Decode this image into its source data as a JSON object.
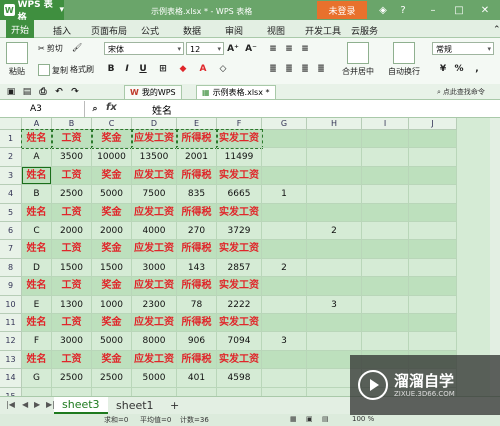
{
  "titlebar": {
    "app_name": "WPS 表格",
    "tabs": [
      "示例表格.xlsx * - WPS 表格"
    ],
    "login": "未登录"
  },
  "ribbon_tabs": [
    "开始",
    "插入",
    "页面布局",
    "公式",
    "数据",
    "审阅",
    "视图",
    "开发工具",
    "云服务"
  ],
  "ribbon": {
    "paste": "粘贴",
    "cut": "剪切",
    "copy": "复制",
    "format_painter": "格式刷",
    "font_name": "宋体",
    "font_size": "12",
    "merge_center": "合并居中",
    "auto_wrap": "自动换行",
    "number_format": "常规"
  },
  "quickbar": {
    "doc_tabs": [
      "我的WPS",
      "示例表格.xlsx *"
    ],
    "search": "点此查找命令"
  },
  "formula": {
    "cell_ref": "A3",
    "fx": "fx",
    "value": "姓名"
  },
  "columns": [
    "A",
    "B",
    "C",
    "D",
    "E",
    "F",
    "G",
    "H",
    "I",
    "J"
  ],
  "rows": [
    {
      "n": "1",
      "header": true,
      "cells": [
        "姓名",
        "工资",
        "奖金",
        "应发工资",
        "所得税",
        "实发工资",
        "",
        "",
        "",
        ""
      ]
    },
    {
      "n": "2",
      "header": false,
      "cells": [
        "A",
        "3500",
        "10000",
        "13500",
        "2001",
        "11499",
        "",
        "",
        "",
        ""
      ]
    },
    {
      "n": "3",
      "header": true,
      "cells": [
        "姓名",
        "工资",
        "奖金",
        "应发工资",
        "所得税",
        "实发工资",
        "",
        "",
        "",
        ""
      ]
    },
    {
      "n": "4",
      "header": false,
      "cells": [
        "B",
        "2500",
        "5000",
        "7500",
        "835",
        "6665",
        "1",
        "",
        "",
        ""
      ]
    },
    {
      "n": "5",
      "header": true,
      "cells": [
        "姓名",
        "工资",
        "奖金",
        "应发工资",
        "所得税",
        "实发工资",
        "",
        "",
        "",
        ""
      ]
    },
    {
      "n": "6",
      "header": false,
      "cells": [
        "C",
        "2000",
        "2000",
        "4000",
        "270",
        "3729",
        "",
        "2",
        "",
        ""
      ]
    },
    {
      "n": "7",
      "header": true,
      "cells": [
        "姓名",
        "工资",
        "奖金",
        "应发工资",
        "所得税",
        "实发工资",
        "",
        "",
        "",
        ""
      ]
    },
    {
      "n": "8",
      "header": false,
      "cells": [
        "D",
        "1500",
        "1500",
        "3000",
        "143",
        "2857",
        "2",
        "",
        "",
        ""
      ]
    },
    {
      "n": "9",
      "header": true,
      "cells": [
        "姓名",
        "工资",
        "奖金",
        "应发工资",
        "所得税",
        "实发工资",
        "",
        "",
        "",
        ""
      ]
    },
    {
      "n": "10",
      "header": false,
      "cells": [
        "E",
        "1300",
        "1000",
        "2300",
        "78",
        "2222",
        "",
        "3",
        "",
        ""
      ]
    },
    {
      "n": "11",
      "header": true,
      "cells": [
        "姓名",
        "工资",
        "奖金",
        "应发工资",
        "所得税",
        "实发工资",
        "",
        "",
        "",
        ""
      ]
    },
    {
      "n": "12",
      "header": false,
      "cells": [
        "F",
        "3000",
        "5000",
        "8000",
        "906",
        "7094",
        "3",
        "",
        "",
        ""
      ]
    },
    {
      "n": "13",
      "header": true,
      "cells": [
        "姓名",
        "工资",
        "奖金",
        "应发工资",
        "所得税",
        "实发工资",
        "",
        "",
        "",
        ""
      ]
    },
    {
      "n": "14",
      "header": false,
      "cells": [
        "G",
        "2500",
        "2500",
        "5000",
        "401",
        "4598",
        "",
        "",
        "",
        ""
      ]
    },
    {
      "n": "15",
      "header": false,
      "cells": [
        "",
        "",
        "",
        "",
        "",
        "",
        "",
        "",
        "",
        ""
      ]
    }
  ],
  "sheets": [
    "sheet3",
    "sheet1"
  ],
  "add_sheet": "+",
  "status": {
    "sum": "求和=0",
    "avg": "平均值=0",
    "count": "计数=36",
    "zoom": "100 %"
  },
  "watermark": {
    "title": "溜溜自学",
    "url": "ZIXUE.3D66.COM"
  },
  "colors": {
    "header_text": "#e0262a",
    "header_fill": "#bde0bd",
    "accent": "#3f8f3f"
  }
}
